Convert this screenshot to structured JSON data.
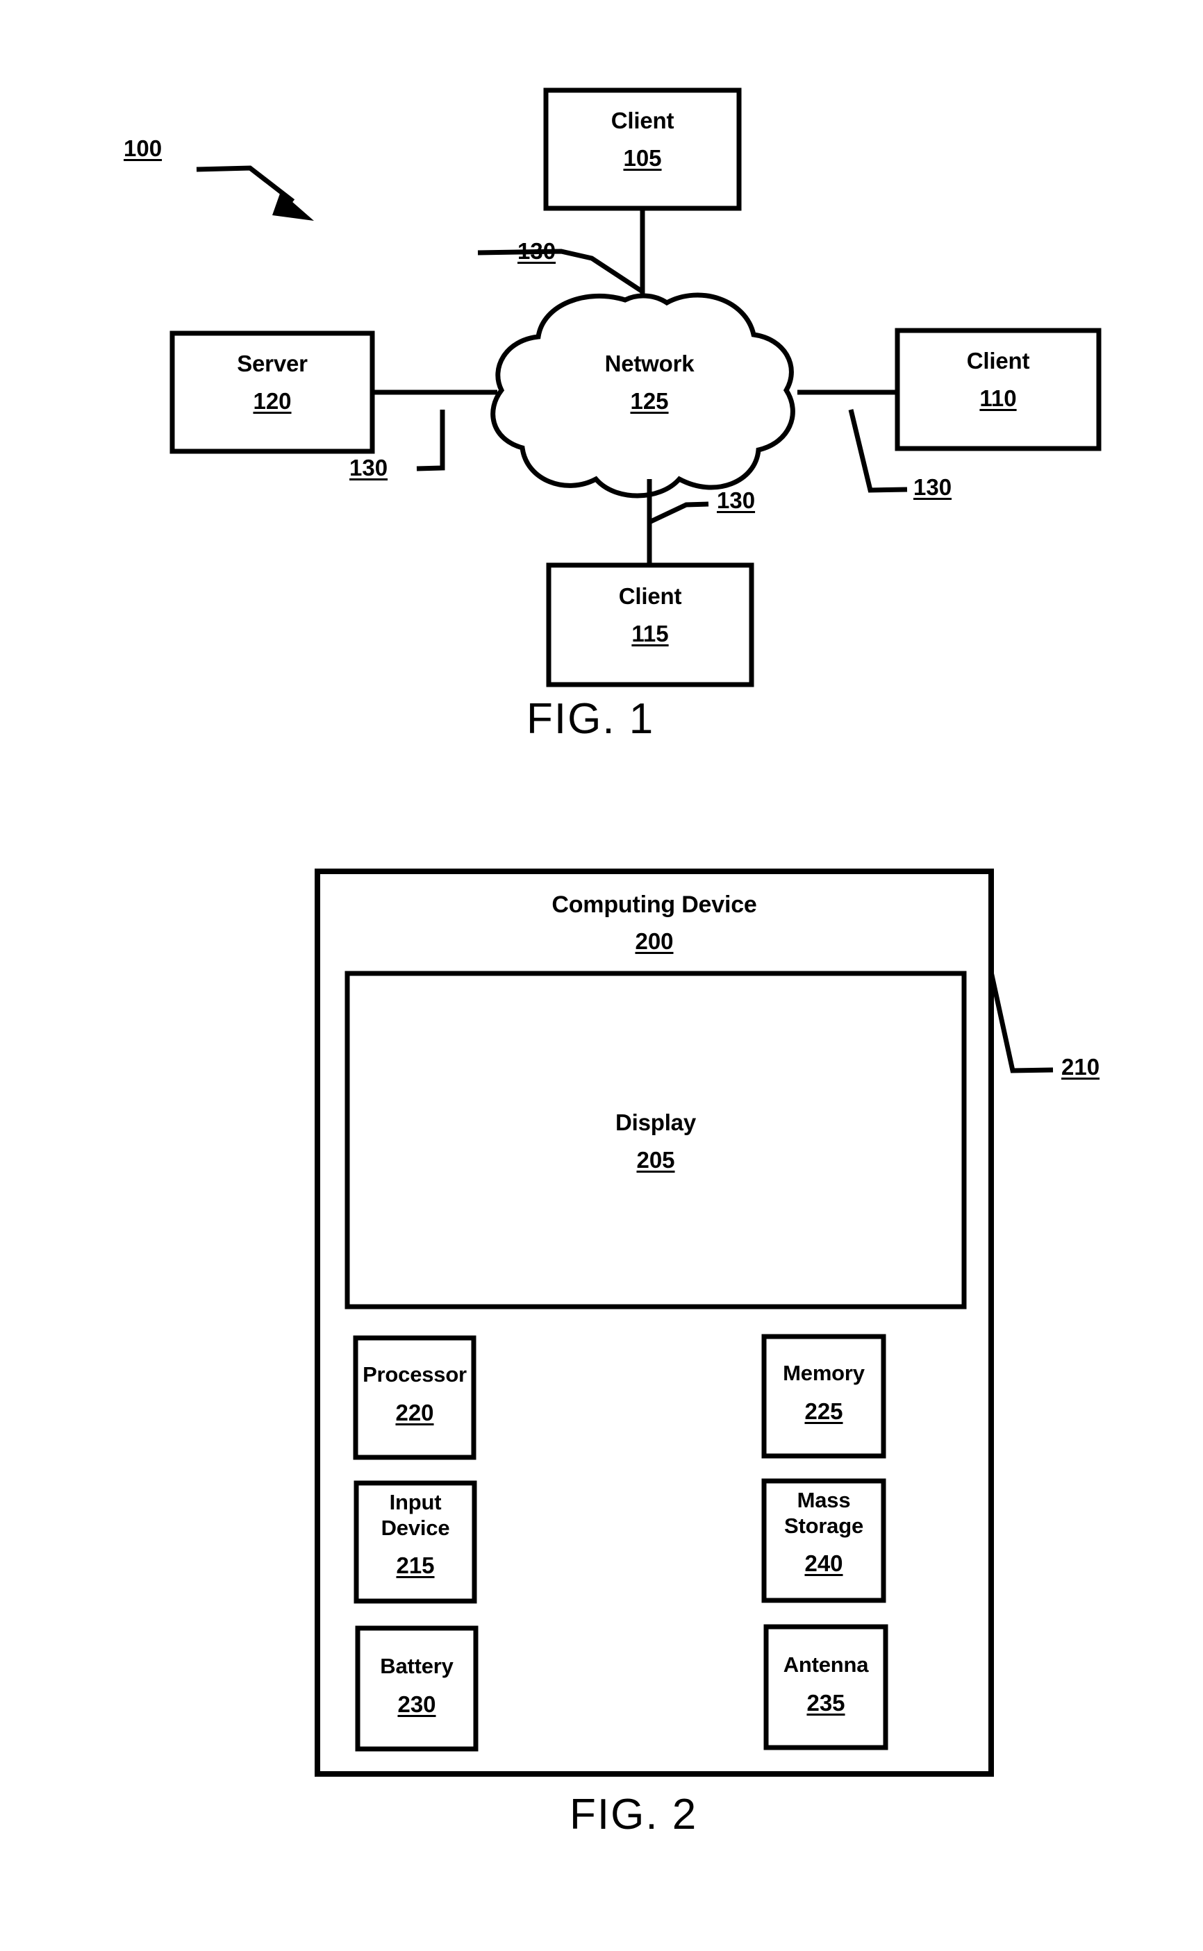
{
  "document": {
    "type": "patent-drawing-sheet",
    "figures": [
      "FIG. 1",
      "FIG. 2"
    ]
  },
  "figure1": {
    "caption": "FIG. 1",
    "system_ref": "100",
    "nodes": {
      "client_top": {
        "label": "Client",
        "number": "105"
      },
      "server": {
        "label": "Server",
        "number": "120"
      },
      "network": {
        "label": "Network",
        "number": "125"
      },
      "client_right": {
        "label": "Client",
        "number": "110"
      },
      "client_bottom": {
        "label": "Client",
        "number": "115"
      }
    },
    "links": [
      {
        "ref": "130",
        "from": "client_top",
        "to": "network"
      },
      {
        "ref": "130",
        "from": "server",
        "to": "network"
      },
      {
        "ref": "130",
        "from": "network",
        "to": "client_right"
      },
      {
        "ref": "130",
        "from": "network",
        "to": "client_bottom"
      }
    ],
    "link_refs": [
      "130",
      "130",
      "130",
      "130"
    ]
  },
  "figure2": {
    "caption": "FIG. 2",
    "device": {
      "label": "Computing Device",
      "number": "200"
    },
    "housing_ref": "210",
    "display": {
      "label": "Display",
      "number": "205"
    },
    "components": [
      {
        "label": "Processor",
        "number": "220",
        "column": "left",
        "row": 1
      },
      {
        "label": "Memory",
        "number": "225",
        "column": "right",
        "row": 1
      },
      {
        "label": "Input\nDevice",
        "number": "215",
        "column": "left",
        "row": 2
      },
      {
        "label": "Mass\nStorage",
        "number": "240",
        "column": "right",
        "row": 2
      },
      {
        "label": "Battery",
        "number": "230",
        "column": "left",
        "row": 3
      },
      {
        "label": "Antenna",
        "number": "235",
        "column": "right",
        "row": 3
      }
    ]
  },
  "colors": {
    "ink": "#000000",
    "paper": "#ffffff"
  }
}
